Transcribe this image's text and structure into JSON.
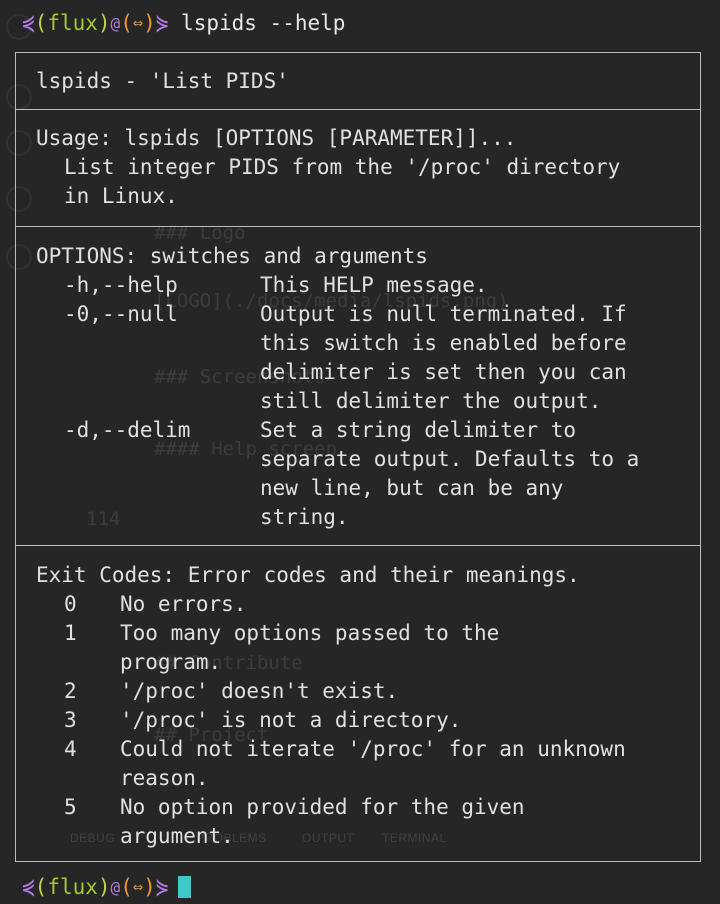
{
  "prompt": {
    "left_arrow": "⋞",
    "open_paren": "(",
    "user": "flux",
    "close_paren": ")",
    "at": "@",
    "host_open": "(",
    "host_glyph": "⇔",
    "host_close": ")",
    "right_arrow": "⋟",
    "command": " lspids --help"
  },
  "help": {
    "title": "lspids - 'List PIDS'",
    "usage": {
      "line": "Usage: lspids [OPTIONS [PARAMETER]]...",
      "description_1": "List integer PIDS from the '/proc' directory",
      "description_2": "in Linux."
    },
    "options": {
      "heading": "OPTIONS: switches and arguments",
      "items": [
        {
          "name": "-h,--help",
          "desc": "This HELP message."
        },
        {
          "name": "-0,--null",
          "desc": "Output is null terminated. If\nthis switch is enabled before\ndelimiter is set then you can\nstill delimiter the output."
        },
        {
          "name": "-d,--delim",
          "desc": "Set a string delimiter to\nseparate output. Defaults to a\nnew line, but can be any\nstring."
        }
      ]
    },
    "exit_codes": {
      "heading": "Exit Codes: Error codes and their meanings.",
      "items": [
        {
          "code": "0",
          "desc": "No errors."
        },
        {
          "code": "1",
          "desc": "Too many options passed to the\nprogram."
        },
        {
          "code": "2",
          "desc": "'/proc' doesn't exist."
        },
        {
          "code": "3",
          "desc": "'/proc' is not a directory."
        },
        {
          "code": "4",
          "desc": "Could not iterate '/proc' for an unknown\nreason."
        },
        {
          "code": "5",
          "desc": "No option provided for the given\nargument."
        }
      ]
    }
  },
  "background_editor": {
    "heading_logo": "### Logo",
    "logo_link": "[LOGO](./docs/media/lspids.png)",
    "heading_screenshots": "### Screenshots",
    "heading_help": "#### Help screen",
    "line_number": "114",
    "heading_contribute": "## Contribute",
    "heading_project": "## Project",
    "panel_tabs": [
      "DEBUG",
      "PROBLEMS",
      "OUTPUT",
      "TERMINAL"
    ]
  },
  "colors": {
    "background": "#262626",
    "border": "#bdbdbd",
    "text": "#e0e0e0",
    "prompt_purple": "#b07ce8",
    "prompt_green": "#a8c832",
    "prompt_orange": "#f0953a",
    "cursor": "#3fc8c8"
  }
}
